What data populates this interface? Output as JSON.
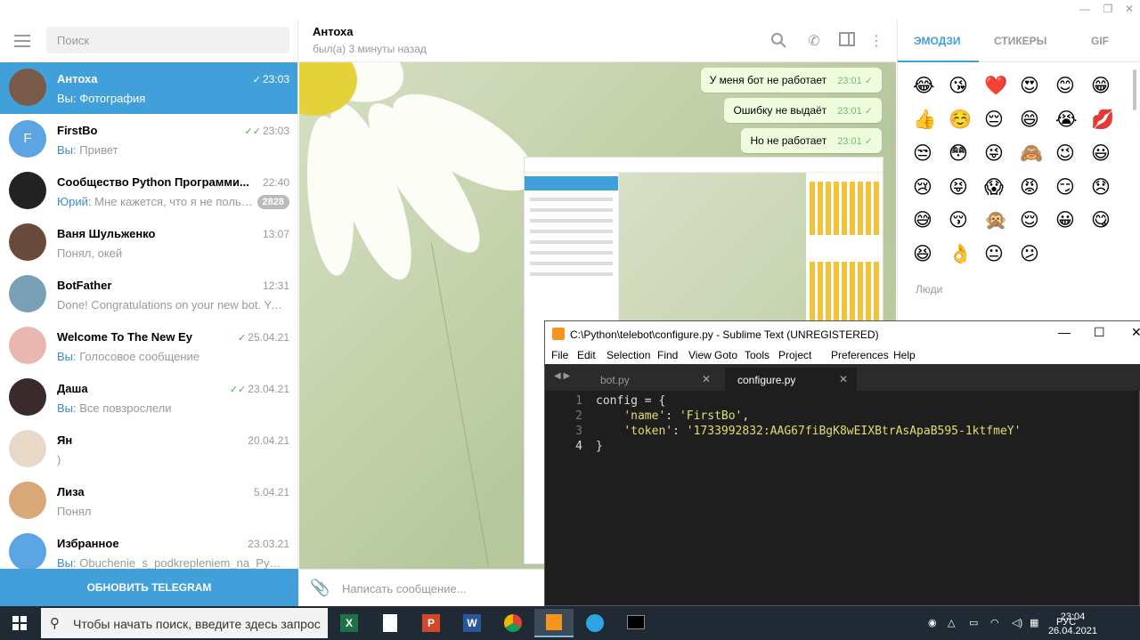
{
  "left": {
    "search_placeholder": "Поиск",
    "dialogs": [
      {
        "name": "Антоха",
        "time": "23:03",
        "you": "Вы:",
        "msg": "Фотография",
        "checks": "✓"
      },
      {
        "name": "FirstBo",
        "time": "23:03",
        "you": "Вы:",
        "msg": "Привет",
        "checks": "✓✓"
      },
      {
        "name": "Сообщество Python Программи...",
        "time": "22:40",
        "you": "Юрий:",
        "msg": "Мне кажется, что я не пользу...",
        "badge": "2828"
      },
      {
        "name": "Ваня Шульженко",
        "time": "13:07",
        "you": "",
        "msg": "Понял, окей"
      },
      {
        "name": "BotFather",
        "time": "12:31",
        "you": "",
        "msg": "Done! Congratulations on your new bot. You ..."
      },
      {
        "name": "Welcome To The New Ey",
        "time": "25.04.21",
        "you": "Вы:",
        "msg": "Голосовое сообщение",
        "checks": "✓"
      },
      {
        "name": "Даша",
        "time": "23.04.21",
        "you": "Вы:",
        "msg": "Все повзрослели",
        "checks": "✓✓"
      },
      {
        "name": "Ян",
        "time": "20.04.21",
        "you": "",
        "msg": ")"
      },
      {
        "name": "Лиза",
        "time": "5.04.21",
        "you": "",
        "msg": "Понял"
      },
      {
        "name": "Избранное",
        "time": "23.03.21",
        "you": "Вы:",
        "msg": "Obuchenie_s_podkrepleniem_na_PyTorc..."
      }
    ],
    "update_label": "ОБНОВИТЬ TELEGRAM",
    "avatar_letter": "F"
  },
  "chat": {
    "peer_name": "Антоха",
    "peer_status": "был(а) 3 минуты назад",
    "messages": [
      {
        "text": "У меня бот не работает",
        "time": "23:01"
      },
      {
        "text": "Ошибку не выдаёт",
        "time": "23:01"
      },
      {
        "text": "Но не работает",
        "time": "23:01"
      }
    ],
    "compose_placeholder": "Написать сообщение..."
  },
  "emoji_panel": {
    "tabs": [
      "ЭМОДЗИ",
      "СТИКЕРЫ",
      "GIF"
    ],
    "emojis": [
      "😂",
      "😘",
      "❤️",
      "😍",
      "😊",
      "😁",
      "👍",
      "☺️",
      "😔",
      "😄",
      "😭",
      "💋",
      "😒",
      "😳",
      "😜",
      "🙈",
      "😉",
      "😃",
      "😢",
      "😝",
      "😱",
      "😡",
      "😏",
      "😞",
      "😅",
      "😚",
      "🙊",
      "😌",
      "😀",
      "😋",
      "😆",
      "👌",
      "😐",
      "😕"
    ],
    "section_people": "Люди"
  },
  "sublime": {
    "title": "C:\\Python\\telebot\\configure.py - Sublime Text (UNREGISTERED)",
    "menu": [
      "File",
      "Edit",
      "Selection",
      "Find",
      "View",
      "Goto",
      "Tools",
      "Project",
      "Preferences",
      "Help"
    ],
    "tabs": [
      "bot.py",
      "configure.py"
    ],
    "lines": [
      "1",
      "2",
      "3",
      "4"
    ],
    "code": {
      "l1_a": "config",
      "l1_b": " = {",
      "l2_key": "'name'",
      "l2_val": "'FirstBo'",
      "l3_key": "'token'",
      "l3_val": "'1733992832:AAG67fiBgK8wEIXBtrAsApaB595-1ktfmeY'",
      "l4": "}"
    }
  },
  "taskbar": {
    "search_text": "Чтобы начать поиск, введите здесь запрос",
    "lang": "РУС",
    "time": "23:04",
    "date": "26.04.2021"
  }
}
